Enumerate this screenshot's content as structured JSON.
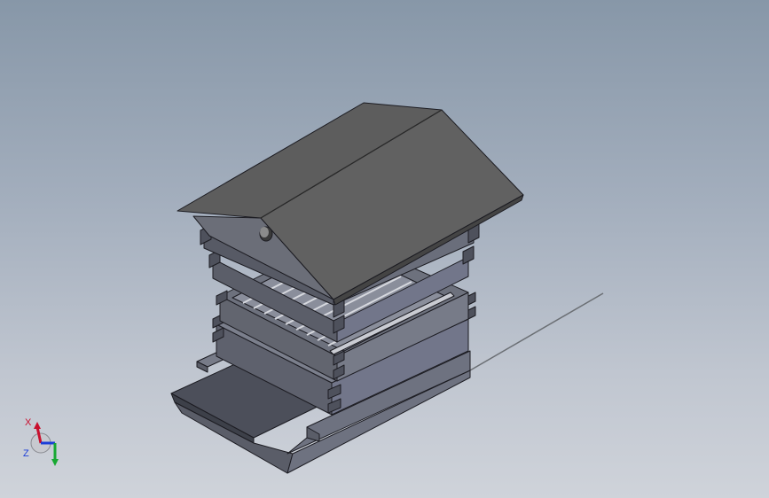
{
  "viewport": {
    "background_top": "#8797a8",
    "background_bottom": "#cfd3da"
  },
  "model": {
    "name": "beehive-assembly",
    "colors": {
      "roof_top": "#5f5f5f",
      "roof_side": "#555555",
      "body_front": "#6b6f7c",
      "body_side": "#7b7f8c",
      "body_dark": "#4c4f5a",
      "edge": "#1c1c22",
      "highlight": "#c9cbd2"
    }
  },
  "triad": {
    "x_label": "X",
    "z_label": "Z",
    "x_color": "#c8102e",
    "y_color": "#17a832",
    "z_color": "#1d3fd8"
  }
}
